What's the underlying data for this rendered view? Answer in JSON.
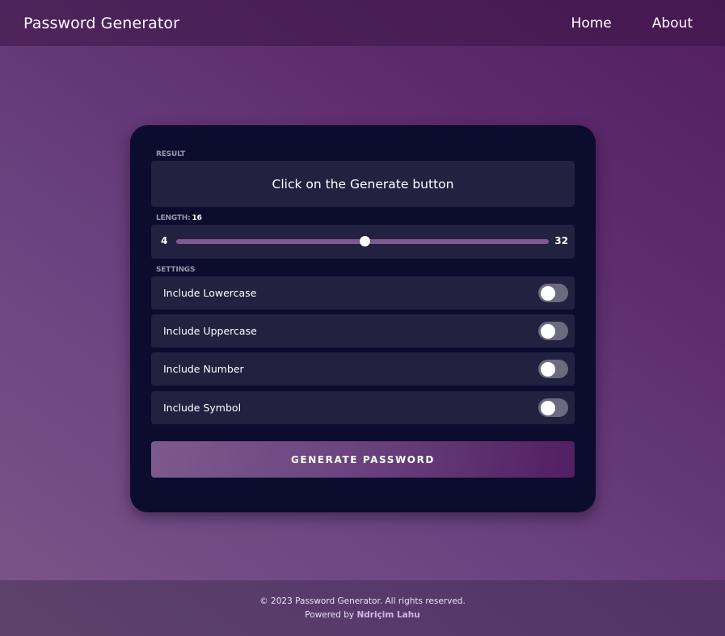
{
  "nav": {
    "brand": "Password Generator",
    "links": [
      "Home",
      "About"
    ]
  },
  "card": {
    "result_label": "RESULT",
    "result_text": "Click on the Generate button",
    "length_label": "LENGTH:",
    "length_value": "16",
    "length_min": "4",
    "length_max": "32",
    "settings_label": "SETTINGS",
    "settings": [
      {
        "label": "Include Lowercase",
        "enabled": false
      },
      {
        "label": "Include Uppercase",
        "enabled": false
      },
      {
        "label": "Include Number",
        "enabled": false
      },
      {
        "label": "Include Symbol",
        "enabled": false
      }
    ],
    "generate_label": "GENERATE PASSWORD"
  },
  "footer": {
    "copyright": "© 2023 Password Generator. All rights reserved.",
    "powered_by": "Powered by",
    "author": "Ndriçim Lahu"
  },
  "colors": {
    "card_bg": "#0c0c2e",
    "panel_bg": "#222140",
    "accent": "#7c5a8d",
    "author_link": "#d7b5ea"
  }
}
